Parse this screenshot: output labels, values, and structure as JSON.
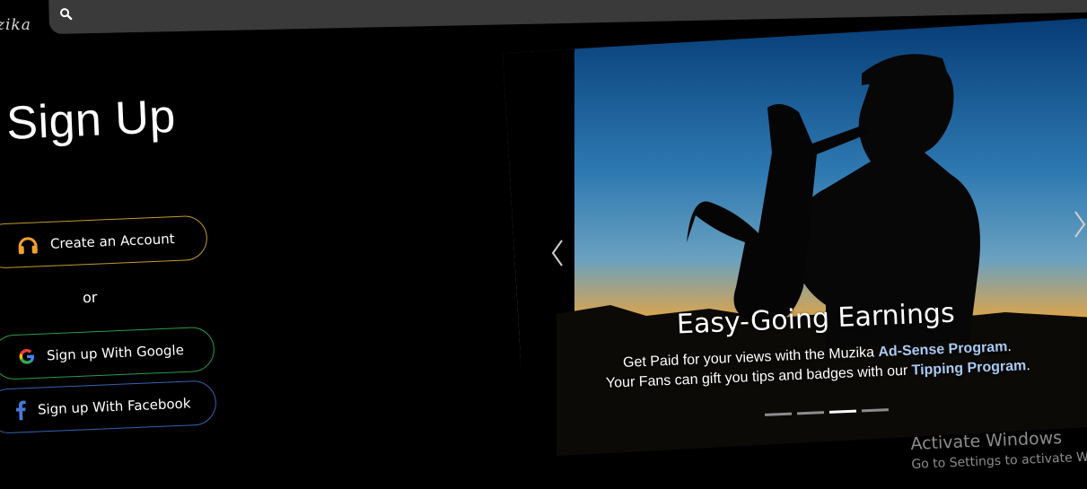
{
  "header": {
    "logo_text": "zika",
    "search_icon": "search-icon"
  },
  "signup": {
    "title": "Sign Up",
    "create_account_label": "Create an Account",
    "create_account_icon": "headphones-icon",
    "or_label": "or",
    "google_label": "Sign up With Google",
    "google_icon": "google-icon",
    "facebook_label": "Sign up With Facebook",
    "facebook_icon": "facebook-icon"
  },
  "carousel": {
    "slide_title": "Easy-Going Earnings",
    "line1_prefix": "Get Paid for your views with the Muzika ",
    "line1_highlight": "Ad-Sense Program",
    "line1_suffix": ".",
    "line2_prefix": "Your Fans can gift you tips and badges with our ",
    "line2_highlight": "Tipping Program",
    "line2_suffix": ".",
    "slide_count": 4,
    "active_index": 2,
    "prev_icon": "chevron-left-icon",
    "next_icon": "chevron-right-icon"
  },
  "watermark": {
    "line1": "Activate Windows",
    "line2": "Go to Settings to activate Win"
  },
  "colors": {
    "background": "#000000",
    "create_border": "#c49a2c",
    "google_border": "#2a9d48",
    "facebook_border": "#3563b4",
    "highlight_text": "#a8cbf4"
  }
}
